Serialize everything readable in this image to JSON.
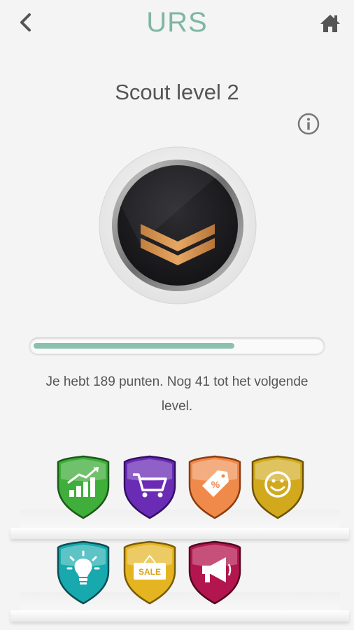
{
  "header": {
    "logo_text": "URS",
    "back_icon": "chevron-left-icon",
    "home_icon": "home-icon"
  },
  "level": {
    "title": "Scout level 2",
    "info_icon": "info-icon",
    "badge_icon": "chevron-rank-icon"
  },
  "progress": {
    "fraction": 0.7,
    "text": "Je hebt 189 punten. Nog 41 tot het volgende level."
  },
  "colors": {
    "accent": "#7fb6a4",
    "progress_fill": "#89c1ad"
  },
  "achievements": [
    {
      "icon": "growth-chart-icon",
      "color": "#3fae3a"
    },
    {
      "icon": "shopping-cart-icon",
      "color": "#6a2bb5"
    },
    {
      "icon": "discount-tag-icon",
      "color": "#f08a4a"
    },
    {
      "icon": "smiley-icon",
      "color": "#d2a91c"
    },
    {
      "icon": "lightbulb-icon",
      "color": "#17a9ad"
    },
    {
      "icon": "sale-sign-icon",
      "color": "#e5b521"
    },
    {
      "icon": "megaphone-icon",
      "color": "#b3164e"
    }
  ]
}
